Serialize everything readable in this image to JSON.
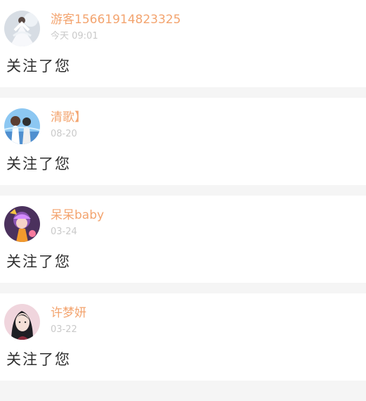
{
  "notifications": [
    {
      "avatar": "dancer-avatar",
      "name": "游客15661914823325",
      "time": "今天 09:01",
      "message": "关注了您"
    },
    {
      "avatar": "anime-sky-avatar",
      "name": "清歌】",
      "time": "08-20",
      "message": "关注了您"
    },
    {
      "avatar": "anime-purple-avatar",
      "name": "呆呆baby",
      "time": "03-24",
      "message": "关注了您"
    },
    {
      "avatar": "portrait-avatar",
      "name": "许梦妍",
      "time": "03-22",
      "message": "关注了您"
    }
  ],
  "colors": {
    "name": "#f3a46f",
    "time": "#c9c9c9",
    "message": "#2f2f2f",
    "divider": "#f5f5f5"
  }
}
